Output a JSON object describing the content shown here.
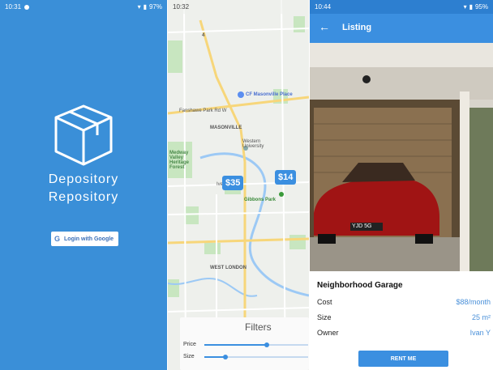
{
  "screen1": {
    "status": {
      "time": "10:31",
      "battery": "97%"
    },
    "app_name_line1": "Depository",
    "app_name_line2": "Repository",
    "login_label": "Login with Google",
    "colors": {
      "background": "#3a8fd8"
    }
  },
  "screen2": {
    "status": {
      "time": "10:32"
    },
    "map_labels": {
      "cf_masonville": "CF Masonville Place",
      "masonville": "MASONVILLE",
      "fanshawe": "Fanshawe Park Rd W",
      "western": "Western University",
      "medway": "Medway Valley Heritage Forest",
      "ivey_school": "Ivey School",
      "gibbons": "Gibbons Park",
      "west_london": "WEST LONDON",
      "route": "4"
    },
    "pins": [
      {
        "label": "$35"
      },
      {
        "label": "$14"
      }
    ],
    "filters": {
      "title": "Filters",
      "price_label": "Price",
      "size_label": "Size",
      "price_value": 0.6,
      "size_value": 0.2
    }
  },
  "screen3": {
    "status": {
      "time": "10:44",
      "battery": "95%"
    },
    "appbar_title": "Listing",
    "listing_title": "Neighborhood Garage",
    "rows": [
      {
        "label": "Cost",
        "value": "$88/month"
      },
      {
        "label": "Size",
        "value": "25 m²"
      },
      {
        "label": "Owner",
        "value": "Ivan Y"
      }
    ],
    "rent_label": "RENT ME",
    "plate": "YJD 5G",
    "colors": {
      "accent": "#3b8fe0"
    }
  }
}
